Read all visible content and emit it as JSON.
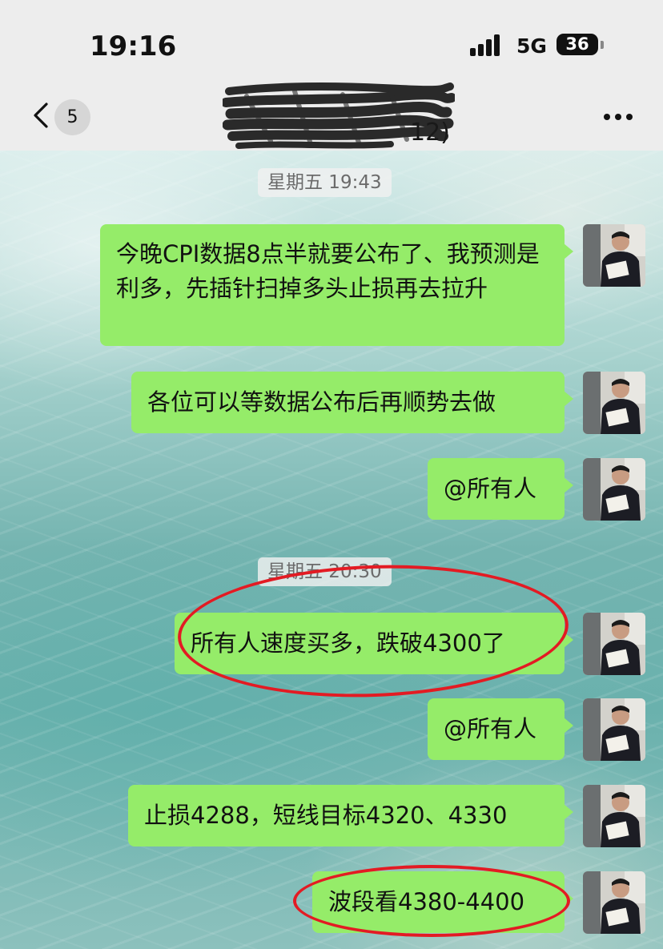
{
  "status_bar": {
    "time": "19:16",
    "network": "5G",
    "battery": "36"
  },
  "nav": {
    "back_badge": "5",
    "title_visible_fragment": "12)"
  },
  "colors": {
    "bubble": "#95ec69",
    "highlight": "#e31b23",
    "bar": "#ededed"
  },
  "messages": [
    {
      "kind": "timestamp",
      "text": "星期五 19:43"
    },
    {
      "kind": "bubble",
      "sender": "self",
      "text": "今晚CPI数据8点半就要公布了、我预测是利多，先插针扫掉多头止损再去拉升"
    },
    {
      "kind": "bubble",
      "sender": "self",
      "text": "各位可以等数据公布后再顺势去做"
    },
    {
      "kind": "bubble",
      "sender": "self",
      "text": "@所有人"
    },
    {
      "kind": "timestamp",
      "text": "星期五 20:30"
    },
    {
      "kind": "bubble",
      "sender": "self",
      "text": "所有人速度买多，跌破4300了",
      "highlighted": true
    },
    {
      "kind": "bubble",
      "sender": "self",
      "text": "@所有人"
    },
    {
      "kind": "bubble",
      "sender": "self",
      "text": "止损4288，短线目标4320、4330"
    },
    {
      "kind": "bubble",
      "sender": "self",
      "text": "波段看4380-4400",
      "highlighted": true
    }
  ]
}
